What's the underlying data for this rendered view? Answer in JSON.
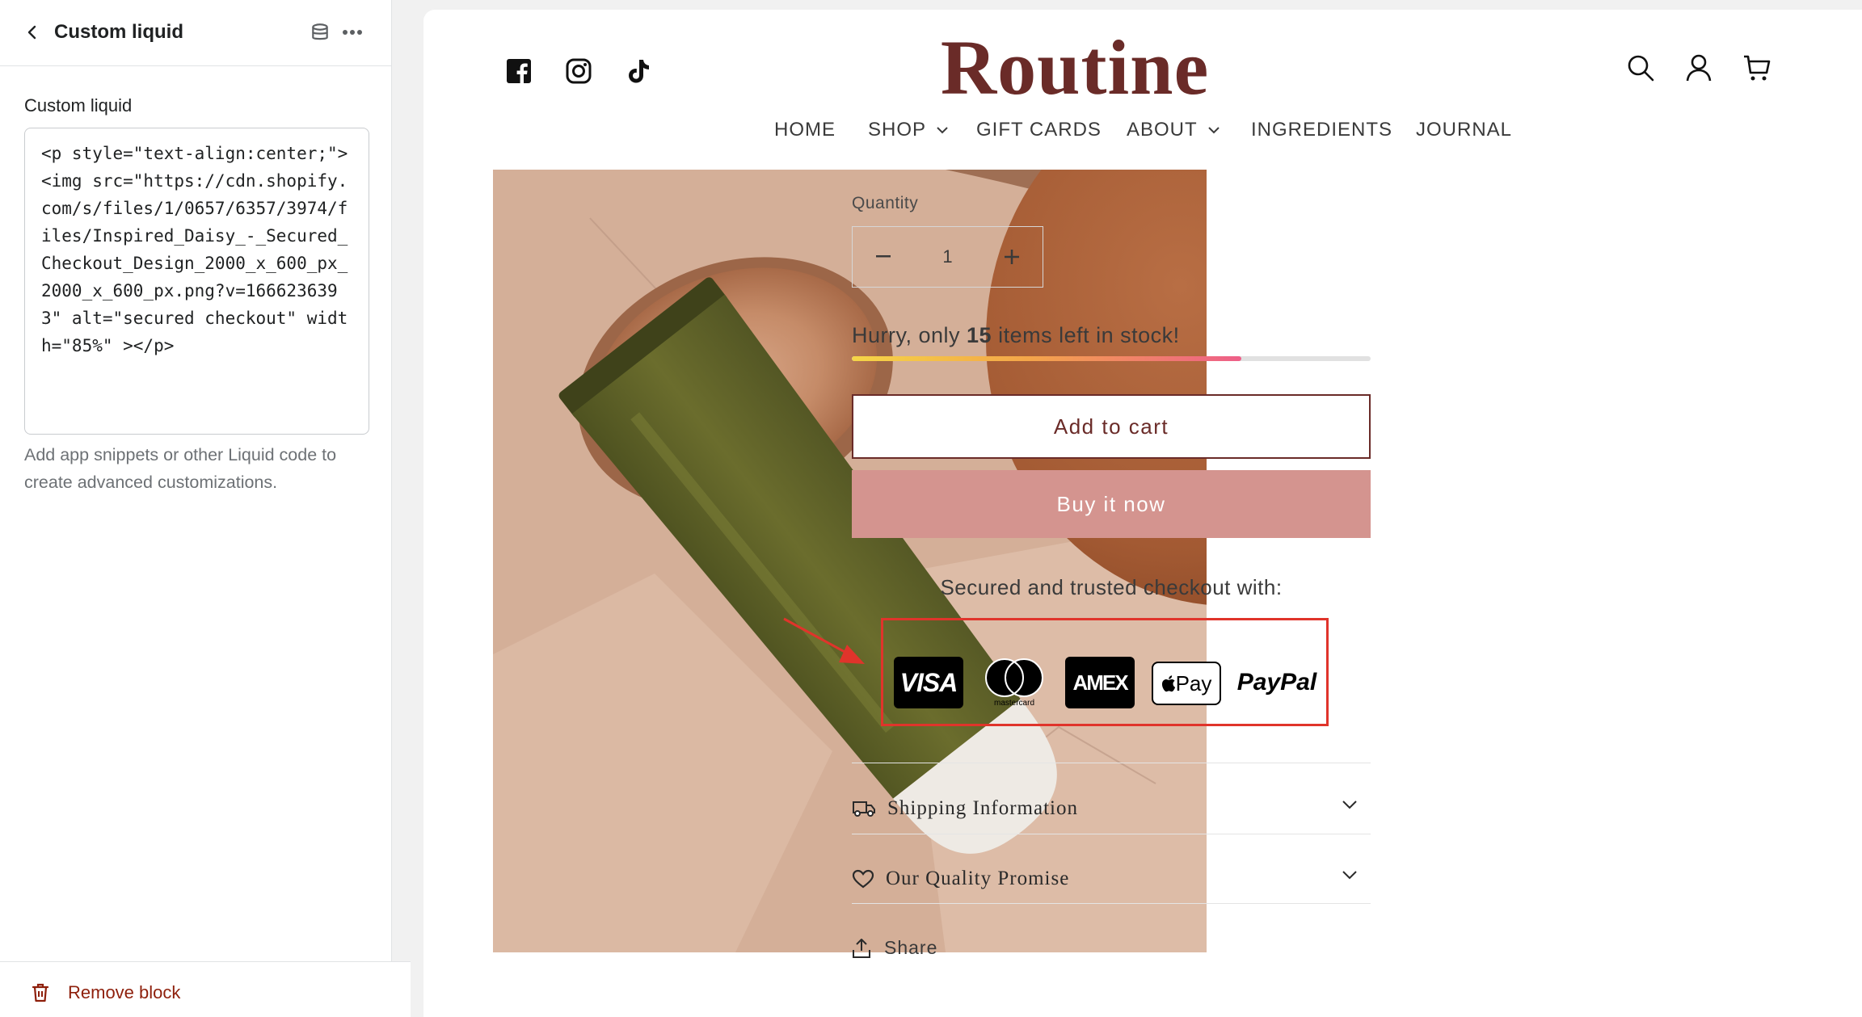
{
  "panel": {
    "title": "Custom liquid",
    "field_label": "Custom liquid",
    "code_value": "<p style=\"text-align:center;\"><img src=\"https://cdn.shopify.com/s/files/1/0657/6357/3974/files/Inspired_Daisy_-_Secured_Checkout_Design_2000_x_600_px_2000_x_600_px.png?v=1666236393\" alt=\"secured checkout\" width=\"85%\" ></p>",
    "help_text": "Add app snippets or other Liquid code to create advanced customizations.",
    "remove_label": "Remove block"
  },
  "store": {
    "logo": "Routine",
    "nav": [
      {
        "label": "HOME"
      },
      {
        "label": "SHOP"
      },
      {
        "label": "GIFT CARDS"
      },
      {
        "label": "ABOUT"
      },
      {
        "label": "INGREDIENTS"
      },
      {
        "label": "JOURNAL"
      }
    ],
    "social_icons": [
      "facebook-icon",
      "instagram-icon",
      "tiktok-icon"
    ],
    "utility_icons": [
      "search-icon",
      "account-icon",
      "cart-icon"
    ]
  },
  "product": {
    "quantity_label": "Quantity",
    "quantity_value": "1",
    "stock_prefix": "Hurry, only ",
    "stock_count": "15",
    "stock_suffix": " items left in stock!",
    "stock_level_fraction": 0.75,
    "add_to_cart": "Add to cart",
    "buy_now": "Buy it now",
    "secured_text": "Secured and trusted checkout with:",
    "payments": {
      "visa": "VISA",
      "mastercard": "mastercard",
      "amex": "AMEX",
      "apple_pay": "Pay",
      "paypal": "PayPal"
    },
    "accordions": [
      {
        "label": "Shipping Information",
        "icon": "truck-icon"
      },
      {
        "label": "Our Quality Promise",
        "icon": "heart-icon"
      }
    ],
    "share_label": "Share"
  },
  "colors": {
    "brand": "#6a2b28",
    "buy_button": "#d4948f",
    "highlight_border": "#e0342b",
    "remove_text": "#8e1f0b"
  }
}
